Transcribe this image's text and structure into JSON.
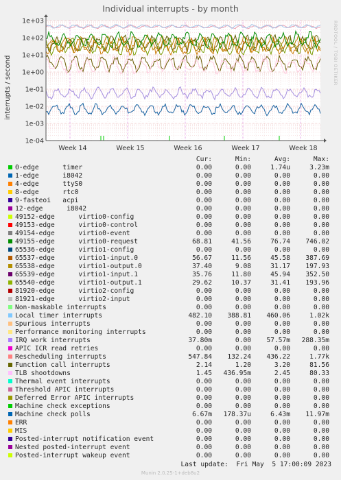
{
  "title": "Individual interrupts - by month",
  "side_text": "RRDTOOL / TOBI OETIKER",
  "chart_data": {
    "type": "line",
    "title": "Individual interrupts - by month",
    "ylabel": "interrupts / second",
    "yscale": "log",
    "ylim": [
      0.0001,
      1000
    ],
    "yticks": [
      "1e-04",
      "1e-03",
      "1e-02",
      "1e-01",
      "1e+00",
      "1e+01",
      "1e+02",
      "1e+03"
    ],
    "xticks": [
      "Week 14",
      "Week 15",
      "Week 16",
      "Week 17",
      "Week 18"
    ],
    "grid": true,
    "series": [
      {
        "name": "Rescheduling interrupts",
        "color": "#e7a0b4",
        "level": 436.22
      },
      {
        "name": "Local timer interrupts",
        "color": "#a3c6e8",
        "level": 460.06
      },
      {
        "name": "virtio1-output.1",
        "color": "#7a9b00",
        "level": 31.41
      },
      {
        "name": "virtio1-input.1",
        "color": "#5e5e00",
        "level": 45.94
      },
      {
        "name": "virtio1-output.0",
        "color": "#cc7700",
        "level": 31.17
      },
      {
        "name": "virtio1-input.0",
        "color": "#b88300",
        "level": 45.58
      },
      {
        "name": "virtio0-request",
        "color": "#008a00",
        "level": 76.74
      },
      {
        "name": "Function call interrupts",
        "color": "#6a5a00",
        "level": 3.2
      },
      {
        "name": "TLB shootdowns",
        "color": "#ffcce0",
        "level": 2.45
      },
      {
        "name": "IRQ work interrupts",
        "color": "#a58fe0",
        "level": 0.05757
      },
      {
        "name": "Machine check polls",
        "color": "#1560a0",
        "level": 0.00643
      },
      {
        "name": "timer",
        "color": "#00cc00",
        "level": 0.0001
      }
    ],
    "legend_header": {
      "cur": "Cur:",
      "min": "Min:",
      "avg": "Avg:",
      "max": "Max:"
    },
    "rows": [
      {
        "name": "0-edge      timer",
        "color": "#00cc00",
        "cur": "0.00",
        "min": "0.00",
        "avg": "1.74u",
        "max": "3.23m"
      },
      {
        "name": "1-edge      i8042",
        "color": "#0066b3",
        "cur": "0.00",
        "min": "0.00",
        "avg": "0.00",
        "max": "0.00"
      },
      {
        "name": "4-edge      ttyS0",
        "color": "#ff8000",
        "cur": "0.00",
        "min": "0.00",
        "avg": "0.00",
        "max": "0.00"
      },
      {
        "name": "8-edge      rtc0",
        "color": "#ffcc00",
        "cur": "0.00",
        "min": "0.00",
        "avg": "0.00",
        "max": "0.00"
      },
      {
        "name": "9-fasteoi   acpi",
        "color": "#330099",
        "cur": "0.00",
        "min": "0.00",
        "avg": "0.00",
        "max": "0.00"
      },
      {
        "name": "12-edge      i8042",
        "color": "#990099",
        "cur": "0.00",
        "min": "0.00",
        "avg": "0.00",
        "max": "0.00"
      },
      {
        "name": "49152-edge      virtio0-config",
        "color": "#ccff00",
        "cur": "0.00",
        "min": "0.00",
        "avg": "0.00",
        "max": "0.00"
      },
      {
        "name": "49153-edge      virtio0-control",
        "color": "#ff0000",
        "cur": "0.00",
        "min": "0.00",
        "avg": "0.00",
        "max": "0.00"
      },
      {
        "name": "49154-edge      virtio0-event",
        "color": "#808080",
        "cur": "0.00",
        "min": "0.00",
        "avg": "0.00",
        "max": "0.00"
      },
      {
        "name": "49155-edge      virtio0-request",
        "color": "#008f00",
        "cur": "68.81",
        "min": "41.56",
        "avg": "76.74",
        "max": "746.02"
      },
      {
        "name": "65536-edge      virtio1-config",
        "color": "#00487d",
        "cur": "0.00",
        "min": "0.00",
        "avg": "0.00",
        "max": "0.00"
      },
      {
        "name": "65537-edge      virtio1-input.0",
        "color": "#b35a00",
        "cur": "56.67",
        "min": "11.56",
        "avg": "45.58",
        "max": "387.69"
      },
      {
        "name": "65538-edge      virtio1-output.0",
        "color": "#b38f00",
        "cur": "37.40",
        "min": "9.08",
        "avg": "31.17",
        "max": "197.93"
      },
      {
        "name": "65539-edge      virtio1-input.1",
        "color": "#6b006b",
        "cur": "35.76",
        "min": "11.80",
        "avg": "45.94",
        "max": "352.50"
      },
      {
        "name": "65540-edge      virtio1-output.1",
        "color": "#8fb300",
        "cur": "29.62",
        "min": "10.37",
        "avg": "31.41",
        "max": "193.96"
      },
      {
        "name": "81920-edge      virtio2-config",
        "color": "#b30000",
        "cur": "0.00",
        "min": "0.00",
        "avg": "0.00",
        "max": "0.00"
      },
      {
        "name": "81921-edge      virtio2-input",
        "color": "#bebebe",
        "cur": "0.00",
        "min": "0.00",
        "avg": "0.00",
        "max": "0.00"
      },
      {
        "name": "Non-maskable interrupts",
        "color": "#80ff80",
        "cur": "0.00",
        "min": "0.00",
        "avg": "0.00",
        "max": "0.00"
      },
      {
        "name": "Local timer interrupts",
        "color": "#80c9ff",
        "cur": "482.10",
        "min": "388.81",
        "avg": "460.06",
        "max": "1.02k"
      },
      {
        "name": "Spurious interrupts",
        "color": "#ffc080",
        "cur": "0.00",
        "min": "0.00",
        "avg": "0.00",
        "max": "0.00"
      },
      {
        "name": "Performance monitoring interrupts",
        "color": "#ffe680",
        "cur": "0.00",
        "min": "0.00",
        "avg": "0.00",
        "max": "0.00"
      },
      {
        "name": "IRQ work interrupts",
        "color": "#aa80ff",
        "cur": "37.80m",
        "min": "0.00",
        "avg": "57.57m",
        "max": "288.35m"
      },
      {
        "name": "APIC ICR read retries",
        "color": "#ee00cc",
        "cur": "0.00",
        "min": "0.00",
        "avg": "0.00",
        "max": "0.00"
      },
      {
        "name": "Rescheduling interrupts",
        "color": "#ff8080",
        "cur": "547.84",
        "min": "132.24",
        "avg": "436.22",
        "max": "1.77k"
      },
      {
        "name": "Function call interrupts",
        "color": "#666600",
        "cur": "2.14",
        "min": "1.20",
        "avg": "3.20",
        "max": "81.56"
      },
      {
        "name": "TLB shootdowns",
        "color": "#ffbfff",
        "cur": "1.45",
        "min": "436.95m",
        "avg": "2.45",
        "max": "80.33"
      },
      {
        "name": "Thermal event interrupts",
        "color": "#00ffcc",
        "cur": "0.00",
        "min": "0.00",
        "avg": "0.00",
        "max": "0.00"
      },
      {
        "name": "Threshold APIC interrupts",
        "color": "#cc6699",
        "cur": "0.00",
        "min": "0.00",
        "avg": "0.00",
        "max": "0.00"
      },
      {
        "name": "Deferred Error APIC interrupts",
        "color": "#999900",
        "cur": "0.00",
        "min": "0.00",
        "avg": "0.00",
        "max": "0.00"
      },
      {
        "name": "Machine check exceptions",
        "color": "#00cc00",
        "cur": "0.00",
        "min": "0.00",
        "avg": "0.00",
        "max": "0.00"
      },
      {
        "name": "Machine check polls",
        "color": "#0066b3",
        "cur": "6.67m",
        "min": "178.37u",
        "avg": "6.43m",
        "max": "11.97m"
      },
      {
        "name": "ERR",
        "color": "#ff8000",
        "cur": "0.00",
        "min": "0.00",
        "avg": "0.00",
        "max": "0.00"
      },
      {
        "name": "MIS",
        "color": "#ffcc00",
        "cur": "0.00",
        "min": "0.00",
        "avg": "0.00",
        "max": "0.00"
      },
      {
        "name": "Posted-interrupt notification event",
        "color": "#330099",
        "cur": "0.00",
        "min": "0.00",
        "avg": "0.00",
        "max": "0.00"
      },
      {
        "name": "Nested posted-interrupt event",
        "color": "#990099",
        "cur": "0.00",
        "min": "0.00",
        "avg": "0.00",
        "max": "0.00"
      },
      {
        "name": "Posted-interrupt wakeup event",
        "color": "#ccff00",
        "cur": "0.00",
        "min": "0.00",
        "avg": "0.00",
        "max": "0.00"
      }
    ]
  },
  "last_update": "Last update:  Fri May  5 17:00:09 2023",
  "footer": "Munin 2.0.25-1+deb8u2"
}
